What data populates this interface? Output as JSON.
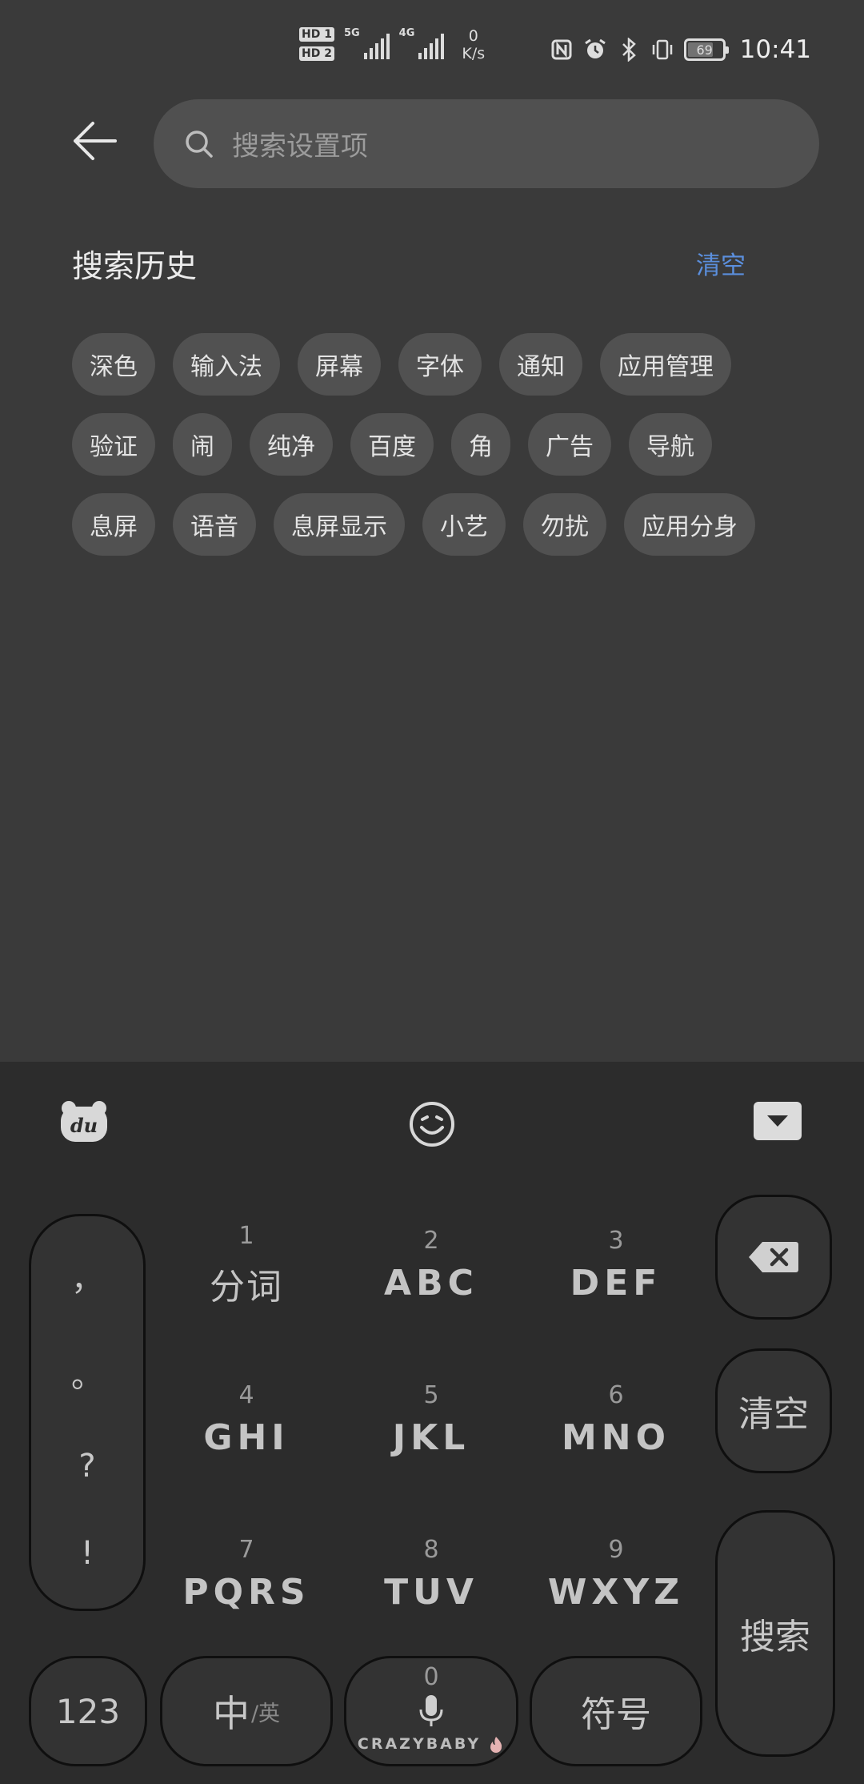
{
  "status_bar": {
    "sim1": "HD 1",
    "sim2": "HD 2",
    "network1": "5G",
    "network2": "4G",
    "speed_value": "0",
    "speed_unit": "K/s",
    "battery": "69",
    "time": "10:41",
    "icons": [
      "nfc-icon",
      "alarm-icon",
      "bluetooth-icon",
      "vibrate-icon",
      "battery-icon"
    ]
  },
  "search": {
    "placeholder": "搜索设置项"
  },
  "history": {
    "title": "搜索历史",
    "clear_label": "清空",
    "rows": [
      [
        "深色",
        "输入法",
        "屏幕",
        "字体",
        "通知",
        "应用管理"
      ],
      [
        "验证",
        "闹",
        "纯净",
        "百度",
        "角",
        "广告",
        "导航"
      ],
      [
        "息屏",
        "语音",
        "息屏显示",
        "小艺",
        "勿扰",
        "应用分身"
      ]
    ]
  },
  "keyboard": {
    "punctuation": [
      "，",
      "。",
      "?",
      "!"
    ],
    "keys": [
      {
        "num": "1",
        "label": "分词"
      },
      {
        "num": "2",
        "label": "ABC"
      },
      {
        "num": "3",
        "label": "DEF"
      },
      {
        "num": "4",
        "label": "GHI"
      },
      {
        "num": "5",
        "label": "JKL"
      },
      {
        "num": "6",
        "label": "MNO"
      },
      {
        "num": "7",
        "label": "PQRS"
      },
      {
        "num": "8",
        "label": "TUV"
      },
      {
        "num": "9",
        "label": "WXYZ"
      }
    ],
    "clear_label": "清空",
    "search_label": "搜索",
    "num_label": "123",
    "lang_main": "中",
    "lang_alt": "/英",
    "space_num": "0",
    "space_brand": "CRAZYBABY",
    "symbol_label": "符号"
  }
}
